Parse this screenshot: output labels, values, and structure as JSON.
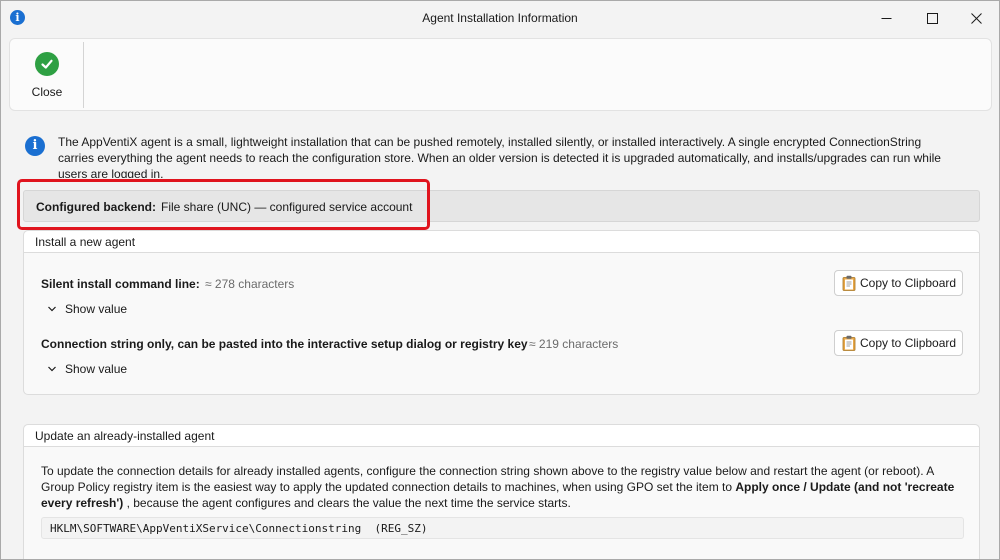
{
  "window": {
    "title": "Agent Installation Information"
  },
  "toolbar": {
    "close_label": "Close"
  },
  "info": {
    "text": "The AppVentiX agent is a small, lightweight installation that can be pushed remotely, installed silently, or installed interactively. A single encrypted ConnectionString carries everything the agent needs to reach the configuration store. When an older version is detected it is upgraded automatically, and installs/upgrades can run while users are logged in."
  },
  "backend": {
    "label": "Configured backend:",
    "value": "File share (UNC) — configured service account"
  },
  "install_group": {
    "title": "Install a new agent",
    "items": [
      {
        "label": "Silent install command line:",
        "count": "≈ 278 characters",
        "show_value": "Show value",
        "copy_label": "Copy to Clipboard"
      },
      {
        "label": "Connection string only, can be pasted into the interactive setup dialog or registry key",
        "count": "≈ 219 characters",
        "show_value": "Show value",
        "copy_label": "Copy to Clipboard"
      }
    ]
  },
  "update_group": {
    "title": "Update an already-installed agent",
    "text_part1": "To update the connection details for already installed agents, configure the connection string shown above to the registry value below and restart the agent (or reboot). A Group Policy registry item is the easiest way to apply the updated connection details to machines, when using GPO set the item to ",
    "text_bold": "Apply once / Update (and not 'recreate every refresh')",
    "text_part2": " , because the agent configures and clears the value the next time the service starts.",
    "registry_path": "HKLM\\SOFTWARE\\AppVentiXService\\Connectionstring  (REG_SZ)"
  },
  "colors": {
    "accent_blue": "#1a6fd1",
    "success_green": "#2ea043",
    "highlight_red": "#e0141e"
  },
  "icons": [
    "info-icon",
    "minimize-icon",
    "maximize-icon",
    "close-icon",
    "check-circle-icon",
    "chevron-down-icon",
    "clipboard-icon"
  ]
}
